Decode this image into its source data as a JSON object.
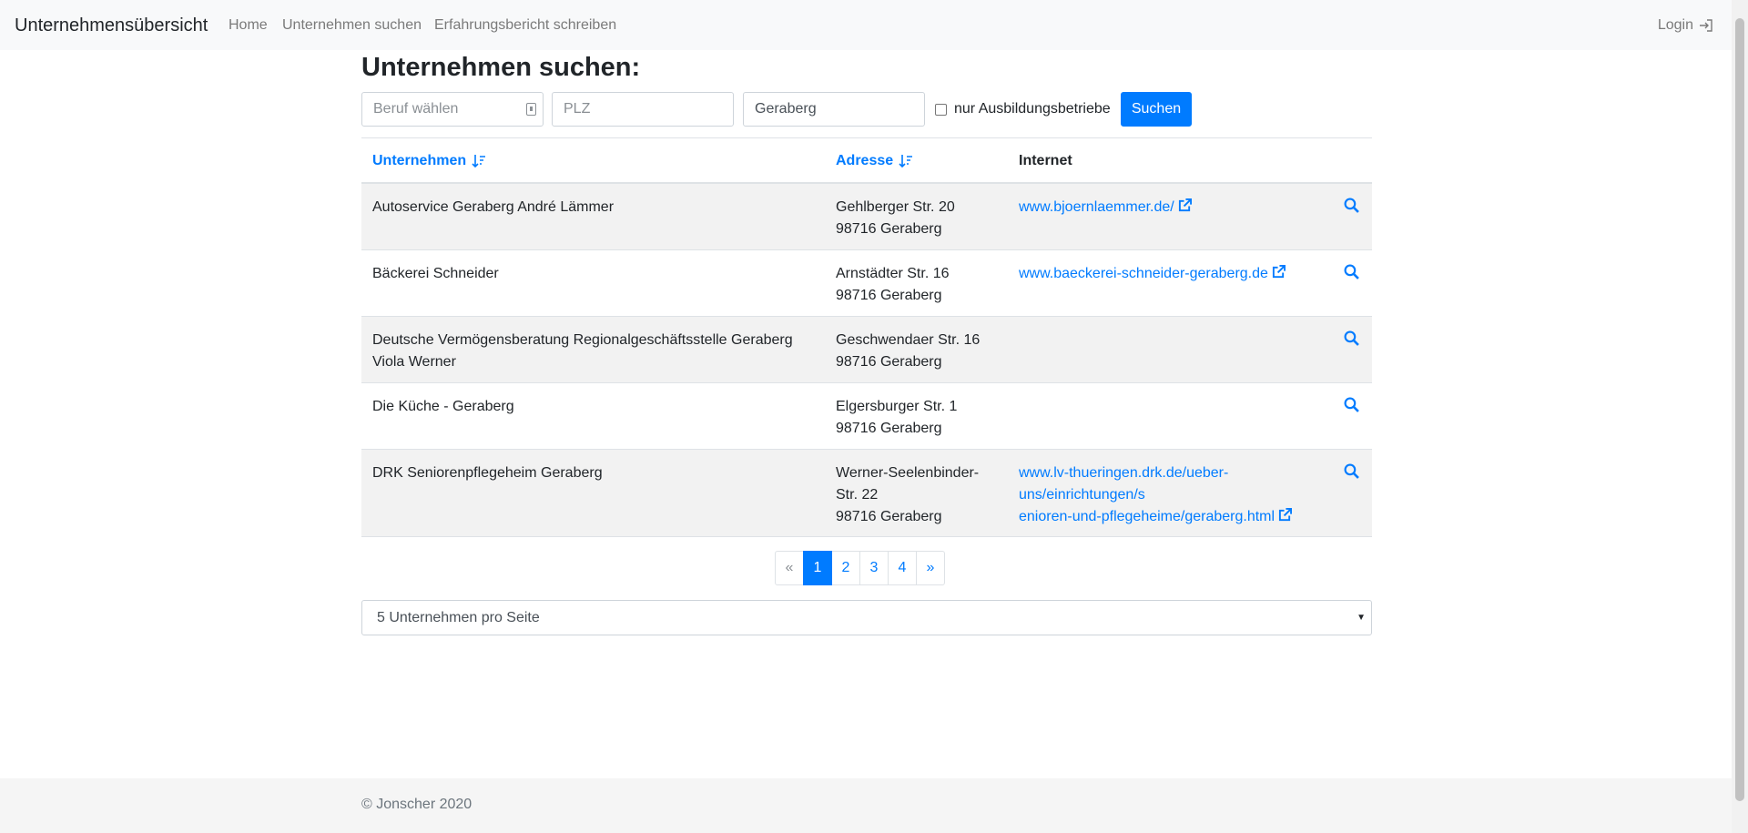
{
  "navbar": {
    "brand": "Unternehmensübersicht",
    "links": [
      "Home",
      "Unternehmen suchen",
      "Erfahrungsbericht schreiben"
    ],
    "login": "Login"
  },
  "page": {
    "title": "Unternehmen suchen:"
  },
  "search": {
    "beruf_placeholder": "Beruf wählen",
    "plz_placeholder": "PLZ",
    "ort_value": "Geraberg",
    "checkbox_label": "nur Ausbildungsbetriebe",
    "checkbox_checked": false,
    "submit_label": "Suchen"
  },
  "table": {
    "headers": {
      "company": "Unternehmen",
      "address": "Adresse",
      "internet": "Internet"
    },
    "rows": [
      {
        "company": [
          "Autoservice Geraberg André Lämmer"
        ],
        "address": [
          "Gehlberger Str. 20",
          "98716 Geraberg"
        ],
        "website": [
          "www.bjoernlaemmer.de/"
        ]
      },
      {
        "company": [
          "Bäckerei Schneider"
        ],
        "address": [
          "Arnstädter Str. 16",
          "98716 Geraberg"
        ],
        "website": [
          "www.baeckerei-schneider-geraberg.de"
        ]
      },
      {
        "company": [
          "Deutsche Vermögensberatung Regionalgeschäftsstelle Geraberg",
          "Viola Werner"
        ],
        "address": [
          "Geschwendaer Str. 16",
          "98716 Geraberg"
        ],
        "website": []
      },
      {
        "company": [
          "Die Küche - Geraberg"
        ],
        "address": [
          "Elgersburger Str. 1",
          "98716 Geraberg"
        ],
        "website": []
      },
      {
        "company": [
          "DRK Seniorenpflegeheim Geraberg"
        ],
        "address": [
          "Werner-Seelenbinder-",
          "Str. 22",
          "98716 Geraberg"
        ],
        "website": [
          "www.lv-thueringen.drk.de/ueber-",
          "uns/einrichtungen/s",
          "enioren-und-pflegeheime/geraberg.html"
        ]
      }
    ]
  },
  "pagination": {
    "prev": "«",
    "pages": [
      "1",
      "2",
      "3",
      "4"
    ],
    "active": "1",
    "next": "»"
  },
  "per_page": {
    "selected": "5 Unternehmen pro Seite"
  },
  "footer": {
    "text": "© Jonscher 2020"
  },
  "colors": {
    "primary": "#007bff",
    "navbar_bg": "#f8f9fa",
    "stripe": "#f2f2f2"
  },
  "icons": {
    "login": "sign-in-icon",
    "sort": "sort-icon",
    "external_link": "external-link-icon",
    "details": "search-icon"
  }
}
